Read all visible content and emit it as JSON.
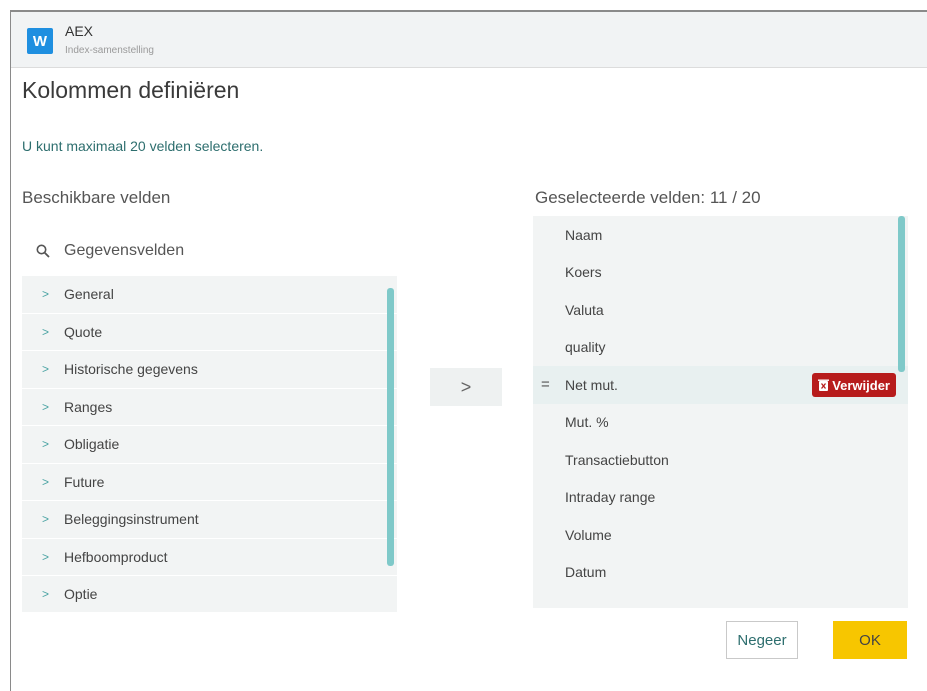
{
  "app": {
    "icon_letter": "W",
    "title": "AEX",
    "subtitle": "Index-samenstelling"
  },
  "dialog": {
    "title": "Kolommen definiëren",
    "info": "U kunt maximaal 20 velden selecteren."
  },
  "available": {
    "label": "Beschikbare velden",
    "search_placeholder": "Gegevensvelden",
    "items": [
      "General",
      "Quote",
      "Historische gegevens",
      "Ranges",
      "Obligatie",
      "Future",
      "Beleggingsinstrument",
      "Hefboomproduct",
      "Optie"
    ]
  },
  "move_button": {
    "label": ">"
  },
  "selected": {
    "label": "Geselecteerde velden: 11 / 20",
    "items": [
      "Naam",
      "Koers",
      "Valuta",
      "quality",
      "Net mut.",
      "Mut. %",
      "Transactiebutton",
      "Intraday range",
      "Volume",
      "Datum"
    ],
    "active_index": 4,
    "drag_handle": "=",
    "remove_label": "Verwijder"
  },
  "footer": {
    "ignore_label": "Negeer",
    "ok_label": "OK"
  },
  "colors": {
    "accent": "#7fc9c9",
    "remove": "#b71c1c",
    "ok": "#f7c600",
    "app_icon": "#1f8fe0"
  }
}
